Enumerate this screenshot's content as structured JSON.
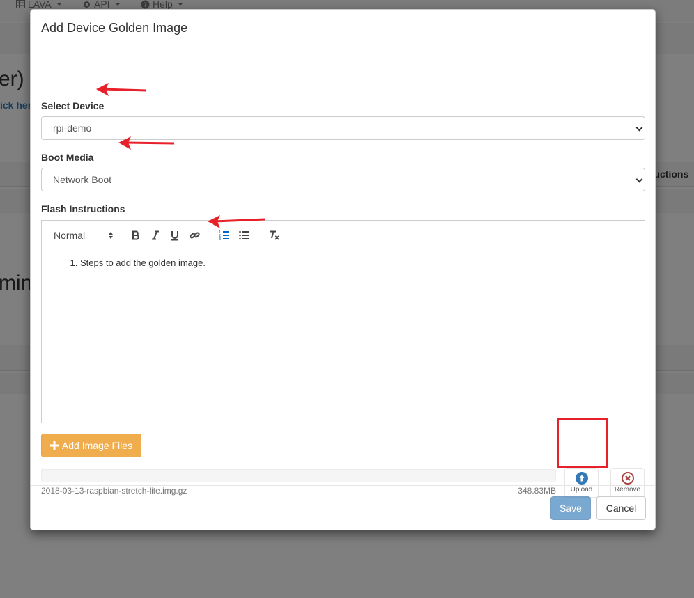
{
  "background": {
    "nav": [
      {
        "label": "LAVA",
        "icon": "table-icon"
      },
      {
        "label": "API",
        "icon": "gear-icon"
      },
      {
        "label": "Help",
        "icon": "question-circle-icon"
      }
    ],
    "heading_1": "er)",
    "link_1": "ick her",
    "heading_2": "min)",
    "table_header": "ructions"
  },
  "modal": {
    "title": "Add Device Golden Image",
    "select_device": {
      "label": "Select Device",
      "value": "rpi-demo"
    },
    "boot_media": {
      "label": "Boot Media",
      "value": "Network Boot"
    },
    "flash_instructions": {
      "label": "Flash Instructions",
      "format": "Normal",
      "items": [
        "Steps to add the golden image."
      ]
    },
    "add_files_label": "Add Image Files",
    "file": {
      "name": "2018-03-13-raspbian-stretch-lite.img.gz",
      "size": "348.83MB",
      "progress": 0
    },
    "upload_label": "Upload",
    "remove_label": "Remove",
    "save_label": "Save",
    "cancel_label": "Cancel"
  },
  "colors": {
    "accent_warning": "#f0ad4e",
    "primary": "#337ab7",
    "danger": "#a94442",
    "annotation": "#e8202a"
  }
}
